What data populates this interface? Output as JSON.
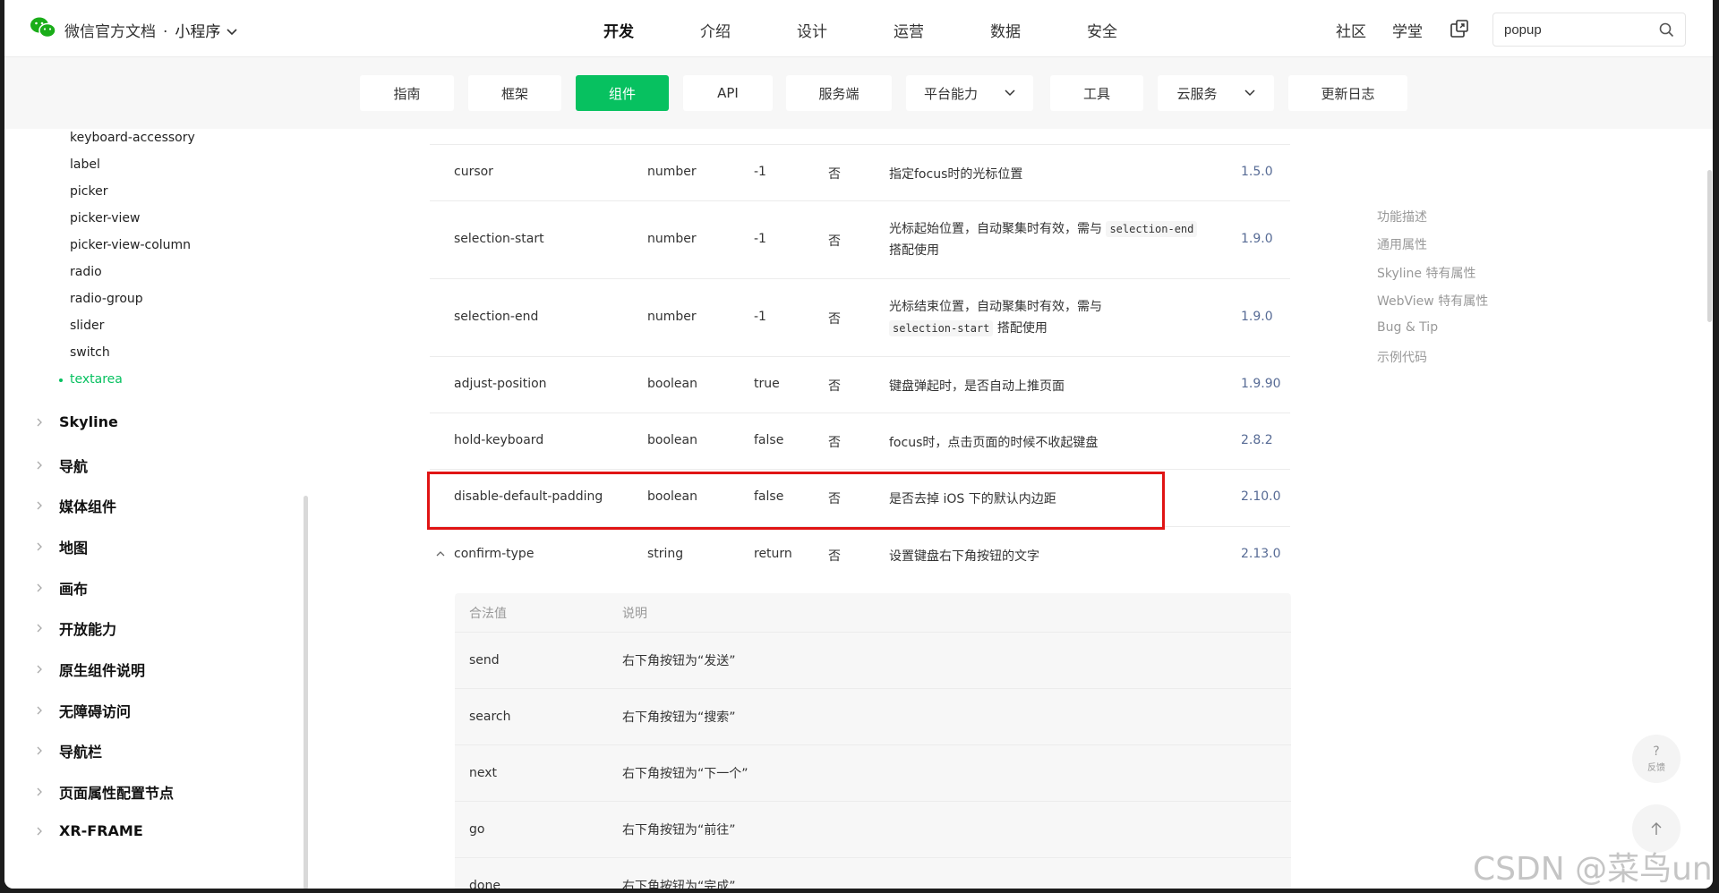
{
  "header": {
    "brand": "微信官方文档",
    "dot": "·",
    "product": "小程序",
    "tabs": [
      "开发",
      "介绍",
      "设计",
      "运营",
      "数据",
      "安全"
    ],
    "active_tab": "开发",
    "links": [
      "社区",
      "学堂"
    ],
    "search_value": "popup"
  },
  "subnav": {
    "items": [
      "指南",
      "框架",
      "组件",
      "API",
      "服务端",
      "平台能力",
      "工具",
      "云服务",
      "更新日志"
    ],
    "active": "组件"
  },
  "sidebar": {
    "items": [
      "keyboard-accessory",
      "label",
      "picker",
      "picker-view",
      "picker-view-column",
      "radio",
      "radio-group",
      "slider",
      "switch",
      "textarea"
    ],
    "active_item": "textarea",
    "groups": [
      "Skyline",
      "导航",
      "媒体组件",
      "地图",
      "画布",
      "开放能力",
      "原生组件说明",
      "无障碍访问",
      "导航栏",
      "页面属性配置节点",
      "XR-FRAME"
    ]
  },
  "table": {
    "rows": [
      {
        "name": "cursor",
        "type": "number",
        "default": "-1",
        "required": "否",
        "desc": "指定focus时的光标位置",
        "version": "1.5.0"
      },
      {
        "name": "selection-start",
        "type": "number",
        "default": "-1",
        "required": "否",
        "desc_pre": "光标起始位置，自动聚集时有效，需与",
        "desc_code": "selection-end",
        "desc_post": "搭配使用",
        "version": "1.9.0"
      },
      {
        "name": "selection-end",
        "type": "number",
        "default": "-1",
        "required": "否",
        "desc_pre": "光标结束位置，自动聚集时有效，需与",
        "desc_code": "selection-start",
        "desc_post": "搭配使用",
        "version": "1.9.0"
      },
      {
        "name": "adjust-position",
        "type": "boolean",
        "default": "true",
        "required": "否",
        "desc": "键盘弹起时，是否自动上推页面",
        "version": "1.9.90"
      },
      {
        "name": "hold-keyboard",
        "type": "boolean",
        "default": "false",
        "required": "否",
        "desc": "focus时，点击页面的时候不收起键盘",
        "version": "2.8.2"
      },
      {
        "name": "disable-default-padding",
        "type": "boolean",
        "default": "false",
        "required": "否",
        "desc": "是否去掉 iOS 下的默认内边距",
        "version": "2.10.0"
      },
      {
        "name": "confirm-type",
        "type": "string",
        "default": "return",
        "required": "否",
        "desc": "设置键盘右下角按钮的文字",
        "version": "2.13.0"
      }
    ],
    "subtable": {
      "headers": [
        "合法值",
        "说明"
      ],
      "rows": [
        {
          "value": "send",
          "desc": "右下角按钮为“发送”"
        },
        {
          "value": "search",
          "desc": "右下角按钮为“搜索”"
        },
        {
          "value": "next",
          "desc": "右下角按钮为“下一个”"
        },
        {
          "value": "go",
          "desc": "右下角按钮为“前往”"
        },
        {
          "value": "done",
          "desc": "右下角按钮为“完成”"
        }
      ]
    }
  },
  "toc": [
    "功能描述",
    "通用属性",
    "Skyline 特有属性",
    "WebView 特有属性",
    "Bug & Tip",
    "示例代码"
  ],
  "feedback": {
    "symbol": "?",
    "label": "反馈"
  },
  "watermark": "CSDN @菜鸟una",
  "colors": {
    "accent": "#07c160",
    "version_link": "#576b95",
    "highlight_box": "#e01414"
  }
}
